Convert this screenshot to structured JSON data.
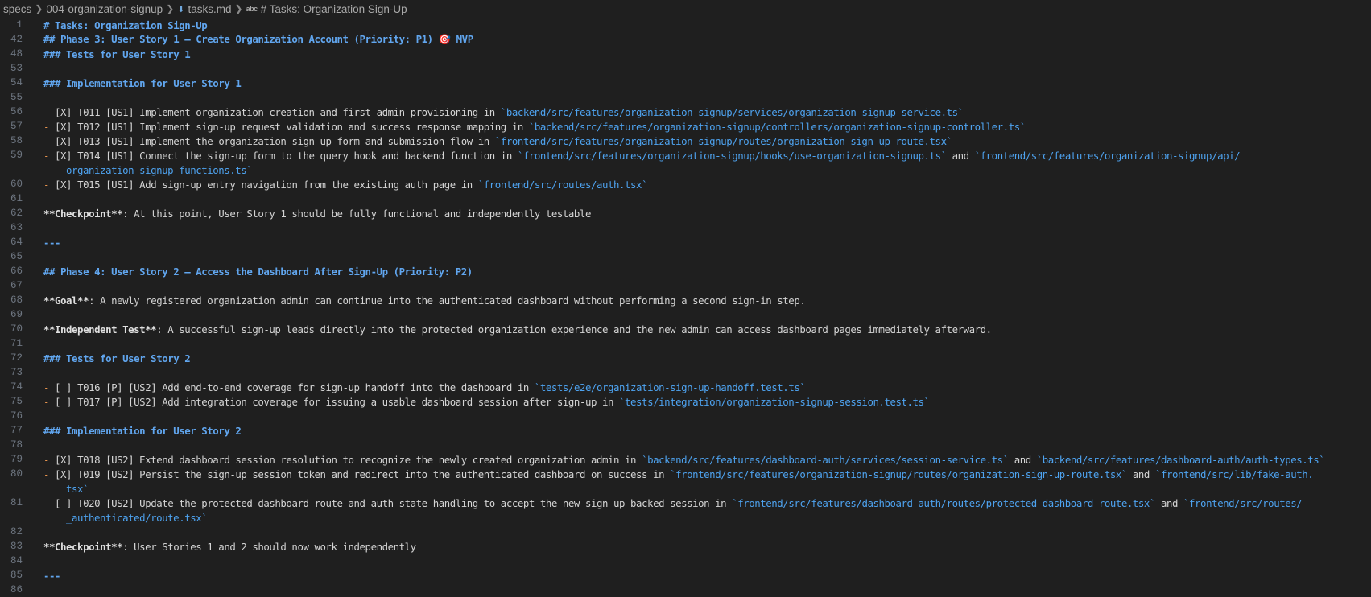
{
  "breadcrumb": {
    "parts": [
      "specs",
      "004-organization-signup",
      "tasks.md",
      "# Tasks: Organization Sign-Up"
    ],
    "abc": "abc"
  },
  "lines": [
    {
      "num": "1",
      "segments": [
        {
          "c": "h",
          "t": "# Tasks: Organization Sign-Up"
        }
      ]
    },
    {
      "num": "42",
      "segments": [
        {
          "c": "h",
          "t": "## Phase 3: User Story 1 – Create Organization Account (Priority: P1) 🎯 MVP"
        }
      ]
    },
    {
      "num": "48",
      "segments": [
        {
          "c": "h",
          "t": "### Tests for User Story 1"
        }
      ]
    },
    {
      "num": "53",
      "segments": []
    },
    {
      "num": "54",
      "segments": [
        {
          "c": "h",
          "t": "### Implementation for User Story 1"
        }
      ]
    },
    {
      "num": "55",
      "segments": []
    },
    {
      "num": "56",
      "segments": [
        {
          "c": "bullet",
          "t": "- "
        },
        {
          "c": "",
          "t": "[X] T011 [US1] Implement organization creation and first-admin provisioning in "
        },
        {
          "c": "code",
          "t": "`backend/src/features/organization-signup/services/organization-signup-service.ts`"
        }
      ]
    },
    {
      "num": "57",
      "segments": [
        {
          "c": "bullet",
          "t": "- "
        },
        {
          "c": "",
          "t": "[X] T012 [US1] Implement sign-up request validation and success response mapping in "
        },
        {
          "c": "code",
          "t": "`backend/src/features/organization-signup/controllers/organization-signup-controller.ts`"
        }
      ]
    },
    {
      "num": "58",
      "segments": [
        {
          "c": "bullet",
          "t": "- "
        },
        {
          "c": "",
          "t": "[X] T013 [US1] Implement the organization sign-up form and submission flow in "
        },
        {
          "c": "code",
          "t": "`frontend/src/features/organization-signup/routes/organization-sign-up-route.tsx`"
        }
      ]
    },
    {
      "num": "59",
      "segments": [
        {
          "c": "bullet",
          "t": "- "
        },
        {
          "c": "",
          "t": "[X] T014 [US1] Connect the sign-up form to the query hook and backend function in "
        },
        {
          "c": "code",
          "t": "`frontend/src/features/organization-signup/hooks/use-organization-signup.ts`"
        },
        {
          "c": "",
          "t": " and "
        },
        {
          "c": "code",
          "t": "`frontend/src/features/organization-signup/api/"
        }
      ]
    },
    {
      "num": "",
      "wrap": true,
      "segments": [
        {
          "c": "code",
          "t": "organization-signup-functions.ts`"
        }
      ]
    },
    {
      "num": "60",
      "segments": [
        {
          "c": "bullet",
          "t": "- "
        },
        {
          "c": "",
          "t": "[X] T015 [US1] Add sign-up entry navigation from the existing auth page in "
        },
        {
          "c": "code",
          "t": "`frontend/src/routes/auth.tsx`"
        }
      ]
    },
    {
      "num": "61",
      "segments": []
    },
    {
      "num": "62",
      "segments": [
        {
          "c": "bold",
          "t": "**Checkpoint**"
        },
        {
          "c": "",
          "t": ": At this point, User Story 1 should be fully functional and independently testable"
        }
      ]
    },
    {
      "num": "63",
      "segments": []
    },
    {
      "num": "64",
      "segments": [
        {
          "c": "rule",
          "t": "---"
        }
      ]
    },
    {
      "num": "65",
      "segments": []
    },
    {
      "num": "66",
      "segments": [
        {
          "c": "h",
          "t": "## Phase 4: User Story 2 – Access the Dashboard After Sign-Up (Priority: P2)"
        }
      ]
    },
    {
      "num": "67",
      "segments": []
    },
    {
      "num": "68",
      "segments": [
        {
          "c": "bold",
          "t": "**Goal**"
        },
        {
          "c": "",
          "t": ": A newly registered organization admin can continue into the authenticated dashboard without performing a second sign-in step."
        }
      ]
    },
    {
      "num": "69",
      "segments": []
    },
    {
      "num": "70",
      "segments": [
        {
          "c": "bold",
          "t": "**Independent Test**"
        },
        {
          "c": "",
          "t": ": A successful sign-up leads directly into the protected organization experience and the new admin can access dashboard pages immediately afterward."
        }
      ]
    },
    {
      "num": "71",
      "segments": []
    },
    {
      "num": "72",
      "segments": [
        {
          "c": "h",
          "t": "### Tests for User Story 2"
        }
      ]
    },
    {
      "num": "73",
      "segments": []
    },
    {
      "num": "74",
      "segments": [
        {
          "c": "bullet",
          "t": "- "
        },
        {
          "c": "",
          "t": "[ ] T016 [P] [US2] Add end-to-end coverage for sign-up handoff into the dashboard in "
        },
        {
          "c": "code",
          "t": "`tests/e2e/organization-sign-up-handoff.test.ts`"
        }
      ]
    },
    {
      "num": "75",
      "segments": [
        {
          "c": "bullet",
          "t": "- "
        },
        {
          "c": "",
          "t": "[ ] T017 [P] [US2] Add integration coverage for issuing a usable dashboard session after sign-up in "
        },
        {
          "c": "code",
          "t": "`tests/integration/organization-signup-session.test.ts`"
        }
      ]
    },
    {
      "num": "76",
      "segments": []
    },
    {
      "num": "77",
      "segments": [
        {
          "c": "h",
          "t": "### Implementation for User Story 2"
        }
      ]
    },
    {
      "num": "78",
      "segments": []
    },
    {
      "num": "79",
      "segments": [
        {
          "c": "bullet",
          "t": "- "
        },
        {
          "c": "",
          "t": "[X] T018 [US2] Extend dashboard session resolution to recognize the newly created organization admin in "
        },
        {
          "c": "code",
          "t": "`backend/src/features/dashboard-auth/services/session-service.ts`"
        },
        {
          "c": "",
          "t": " and "
        },
        {
          "c": "code",
          "t": "`backend/src/features/dashboard-auth/auth-types.ts`"
        }
      ]
    },
    {
      "num": "80",
      "segments": [
        {
          "c": "bullet",
          "t": "- "
        },
        {
          "c": "",
          "t": "[X] T019 [US2] Persist the sign-up session token and redirect into the authenticated dashboard on success in "
        },
        {
          "c": "code",
          "t": "`frontend/src/features/organization-signup/routes/organization-sign-up-route.tsx`"
        },
        {
          "c": "",
          "t": " and "
        },
        {
          "c": "code",
          "t": "`frontend/src/lib/fake-auth."
        }
      ]
    },
    {
      "num": "",
      "wrap": true,
      "segments": [
        {
          "c": "code",
          "t": "tsx`"
        }
      ]
    },
    {
      "num": "81",
      "segments": [
        {
          "c": "bullet",
          "t": "- "
        },
        {
          "c": "",
          "t": "[ ] T020 [US2] Update the protected dashboard route and auth state handling to accept the new sign-up-backed session in "
        },
        {
          "c": "code",
          "t": "`frontend/src/features/dashboard-auth/routes/protected-dashboard-route.tsx`"
        },
        {
          "c": "",
          "t": " and "
        },
        {
          "c": "code",
          "t": "`frontend/src/routes/"
        }
      ]
    },
    {
      "num": "",
      "wrap": true,
      "segments": [
        {
          "c": "code",
          "t": "_authenticated/route.tsx`"
        }
      ]
    },
    {
      "num": "82",
      "segments": []
    },
    {
      "num": "83",
      "segments": [
        {
          "c": "bold",
          "t": "**Checkpoint**"
        },
        {
          "c": "",
          "t": ": User Stories 1 and 2 should now work independently"
        }
      ]
    },
    {
      "num": "84",
      "segments": []
    },
    {
      "num": "85",
      "segments": [
        {
          "c": "rule",
          "t": "---"
        }
      ]
    },
    {
      "num": "86",
      "segments": []
    }
  ]
}
